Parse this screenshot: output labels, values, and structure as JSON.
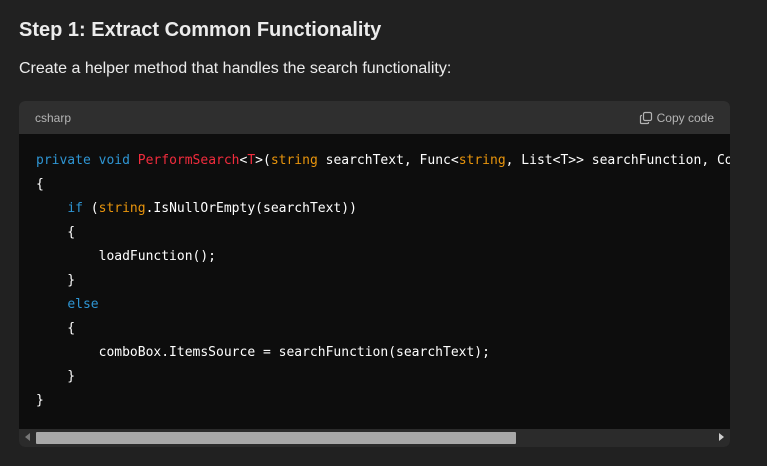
{
  "section": {
    "heading": "Step 1: Extract Common Functionality",
    "description": "Create a helper method that handles the search functionality:"
  },
  "code_block": {
    "language": "csharp",
    "copy_label": "Copy code",
    "lines": [
      [
        {
          "t": "private",
          "c": "kw"
        },
        {
          "t": " "
        },
        {
          "t": "void",
          "c": "kw"
        },
        {
          "t": " "
        },
        {
          "t": "PerformSearch",
          "c": "fn"
        },
        {
          "t": "<"
        },
        {
          "t": "T",
          "c": "fn"
        },
        {
          "t": ">("
        },
        {
          "t": "string",
          "c": "st"
        },
        {
          "t": " searchText, Func<"
        },
        {
          "t": "string",
          "c": "st"
        },
        {
          "t": ", List<T>> searchFunction, Com"
        }
      ],
      [
        {
          "t": "{"
        }
      ],
      [
        {
          "t": "    "
        },
        {
          "t": "if",
          "c": "kw"
        },
        {
          "t": " ("
        },
        {
          "t": "string",
          "c": "st"
        },
        {
          "t": ".IsNullOrEmpty(searchText))"
        }
      ],
      [
        {
          "t": "    {"
        }
      ],
      [
        {
          "t": "        loadFunction();"
        }
      ],
      [
        {
          "t": "    }"
        }
      ],
      [
        {
          "t": "    "
        },
        {
          "t": "else",
          "c": "kw"
        }
      ],
      [
        {
          "t": "    {"
        }
      ],
      [
        {
          "t": "        comboBox.ItemsSource = searchFunction(searchText);"
        }
      ],
      [
        {
          "t": "    }"
        }
      ],
      [
        {
          "t": "}"
        }
      ]
    ]
  },
  "colors": {
    "background": "#212121",
    "code_background": "#0d0d0d",
    "header_background": "#2f2f2f",
    "keyword": "#2e95d3",
    "function_name": "#f22c3d",
    "builtin_type": "#e9950c"
  },
  "icons": {
    "copy": "copy-icon"
  }
}
